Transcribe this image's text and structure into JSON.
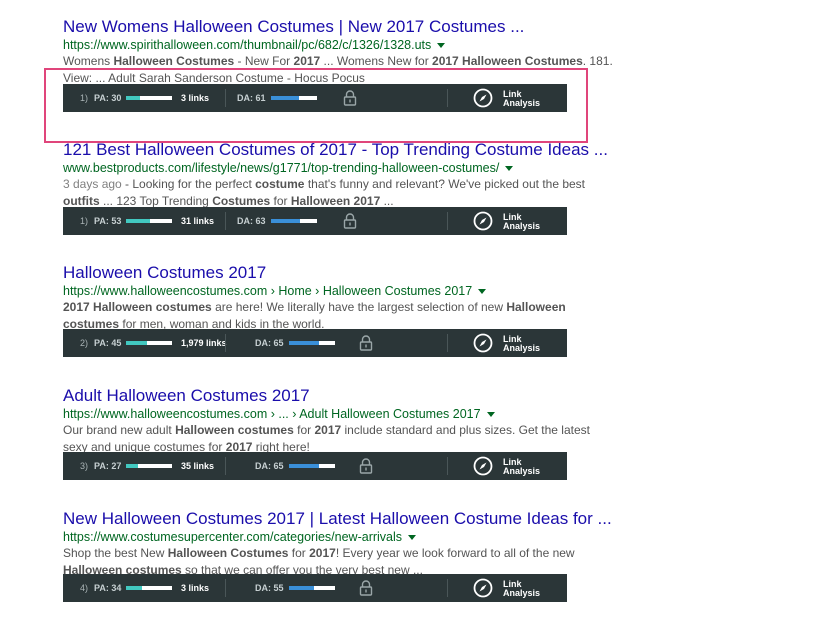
{
  "colors": {
    "link": "#1a0dab",
    "url": "#006621",
    "mozbar_bg": "#2b3638",
    "pa_fill": "#42c8c0",
    "da_fill": "#3a8fd8",
    "highlight": "#e0457b"
  },
  "results": [
    {
      "title": "New Womens Halloween Costumes | New 2017 Costumes ...",
      "url": "https://www.spirithalloween.com/thumbnail/pc/682/c/1326/1328.uts",
      "date": "",
      "line1": [
        {
          "t": "Womens ",
          "b": false
        },
        {
          "t": "Halloween Costumes",
          "b": true
        },
        {
          "t": " - New For ",
          "b": false
        },
        {
          "t": "2017",
          "b": true
        },
        {
          "t": " ... Womens New for ",
          "b": false
        },
        {
          "t": "2017 Halloween Costumes",
          "b": true
        },
        {
          "t": ". 181.",
          "b": false
        }
      ],
      "line2": [
        {
          "t": "View: ... Adult Sarah Sanderson Costume - Hocus Pocus",
          "b": false
        }
      ],
      "moz": {
        "rank": "1)",
        "pa_label": "PA: 30",
        "pa": 30,
        "links": "3 links",
        "da_label": "DA: 61",
        "da": 61,
        "link_analysis": [
          "Link",
          "Analysis"
        ]
      }
    },
    {
      "title": "121 Best Halloween Costumes of 2017 - Top Trending Costume Ideas ...",
      "url": "www.bestproducts.com/lifestyle/news/g1771/top-trending-halloween-costumes/",
      "date": "3 days ago",
      "line1": [
        {
          "t": " - Looking for the perfect ",
          "b": false
        },
        {
          "t": "costume",
          "b": true
        },
        {
          "t": " that's funny and relevant? We've picked out the best",
          "b": false
        }
      ],
      "line2": [
        {
          "t": "outfits",
          "b": true
        },
        {
          "t": " ... 123 Top Trending ",
          "b": false
        },
        {
          "t": "Costumes",
          "b": true
        },
        {
          "t": " for ",
          "b": false
        },
        {
          "t": "Halloween 2017",
          "b": true
        },
        {
          "t": " ...",
          "b": false
        }
      ],
      "moz": {
        "rank": "1)",
        "pa_label": "PA: 53",
        "pa": 53,
        "links": "31 links",
        "da_label": "DA: 63",
        "da": 63,
        "link_analysis": [
          "Link",
          "Analysis"
        ]
      }
    },
    {
      "title": "Halloween Costumes 2017",
      "url": "https://www.halloweencostumes.com › Home › Halloween Costumes 2017",
      "date": "",
      "line1": [
        {
          "t": "2017 Halloween costumes",
          "b": true
        },
        {
          "t": " are here! We literally have the largest selection of new ",
          "b": false
        },
        {
          "t": "Halloween",
          "b": true
        }
      ],
      "line2": [
        {
          "t": "costumes",
          "b": true
        },
        {
          "t": " for men, woman and kids in the world.",
          "b": false
        }
      ],
      "moz": {
        "rank": "2)",
        "pa_label": "PA: 45",
        "pa": 45,
        "links": "1,979 links",
        "da_label": "DA: 65",
        "da": 65,
        "link_analysis": [
          "Link",
          "Analysis"
        ]
      }
    },
    {
      "title": "Adult Halloween Costumes 2017",
      "url": "https://www.halloweencostumes.com › ... › Adult Halloween Costumes 2017",
      "date": "",
      "line1": [
        {
          "t": "Our brand new adult ",
          "b": false
        },
        {
          "t": "Halloween costumes",
          "b": true
        },
        {
          "t": " for ",
          "b": false
        },
        {
          "t": "2017",
          "b": true
        },
        {
          "t": " include standard and plus sizes. Get the latest",
          "b": false
        }
      ],
      "line2": [
        {
          "t": "sexy and unique costumes for ",
          "b": false
        },
        {
          "t": "2017",
          "b": true
        },
        {
          "t": " right here!",
          "b": false
        }
      ],
      "moz": {
        "rank": "3)",
        "pa_label": "PA: 27",
        "pa": 27,
        "links": "35 links",
        "da_label": "DA: 65",
        "da": 65,
        "link_analysis": [
          "Link",
          "Analysis"
        ]
      }
    },
    {
      "title": "New Halloween Costumes 2017 | Latest Halloween Costume Ideas for ...",
      "url": "https://www.costumesupercenter.com/categories/new-arrivals",
      "date": "",
      "line1": [
        {
          "t": "Shop the best New ",
          "b": false
        },
        {
          "t": "Halloween Costumes",
          "b": true
        },
        {
          "t": " for ",
          "b": false
        },
        {
          "t": "2017",
          "b": true
        },
        {
          "t": "! Every year we look forward to all of the new",
          "b": false
        }
      ],
      "line2": [
        {
          "t": "Halloween costumes",
          "b": true
        },
        {
          "t": " so that we can offer you the very best new ...",
          "b": false
        }
      ],
      "moz": {
        "rank": "4)",
        "pa_label": "PA: 34",
        "pa": 34,
        "links": "3 links",
        "da_label": "DA: 55",
        "da": 55,
        "link_analysis": [
          "Link",
          "Analysis"
        ]
      }
    }
  ]
}
